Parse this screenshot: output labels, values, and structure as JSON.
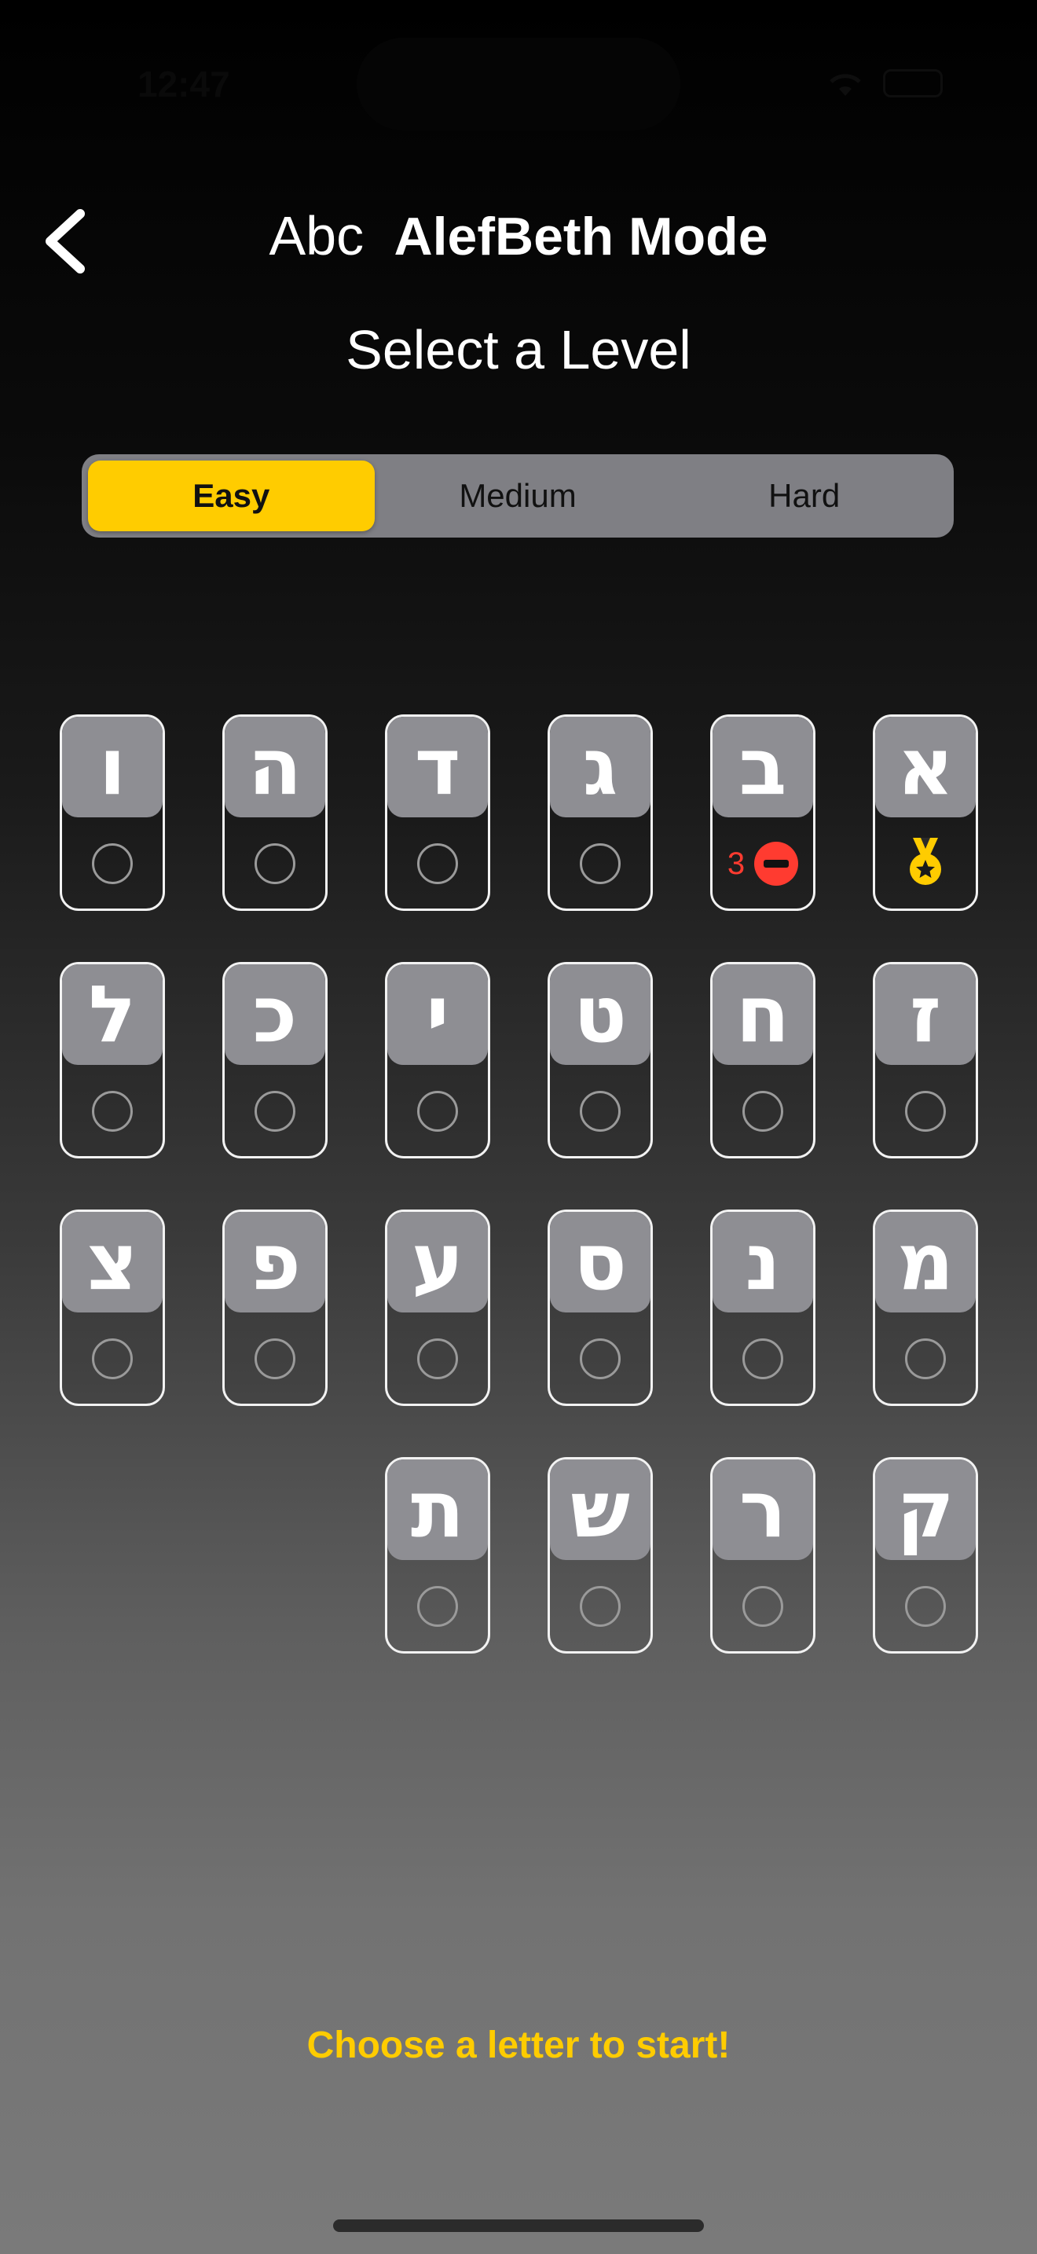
{
  "status_bar": {
    "time": "12:47"
  },
  "header": {
    "abc_label": "Abc",
    "title": "AlefBeth Mode"
  },
  "subtitle": "Select a Level",
  "levels": {
    "options": [
      "Easy",
      "Medium",
      "Hard"
    ],
    "selected": "Easy"
  },
  "letters": [
    {
      "glyph": "א",
      "status": "medal"
    },
    {
      "glyph": "ב",
      "status": "failed",
      "fail_count": "3"
    },
    {
      "glyph": "ג",
      "status": "none"
    },
    {
      "glyph": "ד",
      "status": "none"
    },
    {
      "glyph": "ה",
      "status": "none"
    },
    {
      "glyph": "ו",
      "status": "none"
    },
    {
      "glyph": "ז",
      "status": "none"
    },
    {
      "glyph": "ח",
      "status": "none"
    },
    {
      "glyph": "ט",
      "status": "none"
    },
    {
      "glyph": "י",
      "status": "none"
    },
    {
      "glyph": "כ",
      "status": "none"
    },
    {
      "glyph": "ל",
      "status": "none"
    },
    {
      "glyph": "מ",
      "status": "none"
    },
    {
      "glyph": "נ",
      "status": "none"
    },
    {
      "glyph": "ס",
      "status": "none"
    },
    {
      "glyph": "ע",
      "status": "none"
    },
    {
      "glyph": "פ",
      "status": "none"
    },
    {
      "glyph": "צ",
      "status": "none"
    },
    {
      "glyph": "ק",
      "status": "none"
    },
    {
      "glyph": "ר",
      "status": "none"
    },
    {
      "glyph": "ש",
      "status": "none"
    },
    {
      "glyph": "ת",
      "status": "none"
    }
  ],
  "cta": "Choose a letter to start!",
  "colors": {
    "accent": "#ffcc00",
    "error": "#ff3b30",
    "tile": "#8e8e93"
  }
}
